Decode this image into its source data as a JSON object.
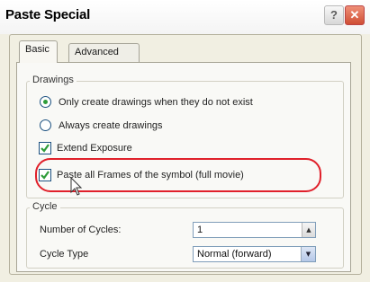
{
  "window": {
    "title": "Paste Special",
    "help_glyph": "?",
    "close_glyph": "✕"
  },
  "tabs": [
    {
      "label": "Basic",
      "selected": true
    },
    {
      "label": "Advanced",
      "selected": false
    }
  ],
  "drawings": {
    "legend": "Drawings",
    "options": [
      {
        "label": "Only create drawings when they do not exist",
        "selected": true
      },
      {
        "label": "Always create drawings",
        "selected": false
      }
    ],
    "extend_exposure": {
      "label": "Extend Exposure",
      "checked": true
    },
    "paste_all_frames": {
      "label": "Paste all Frames of the symbol (full movie)",
      "checked": true
    }
  },
  "cycle": {
    "legend": "Cycle",
    "number_label": "Number of Cycles:",
    "number_value": "1",
    "type_label": "Cycle Type",
    "type_value": "Normal (forward)"
  },
  "colors": {
    "accent_highlight": "#e0202a",
    "radio_dot": "#2e9c39",
    "check_mark": "#2e9c39"
  }
}
